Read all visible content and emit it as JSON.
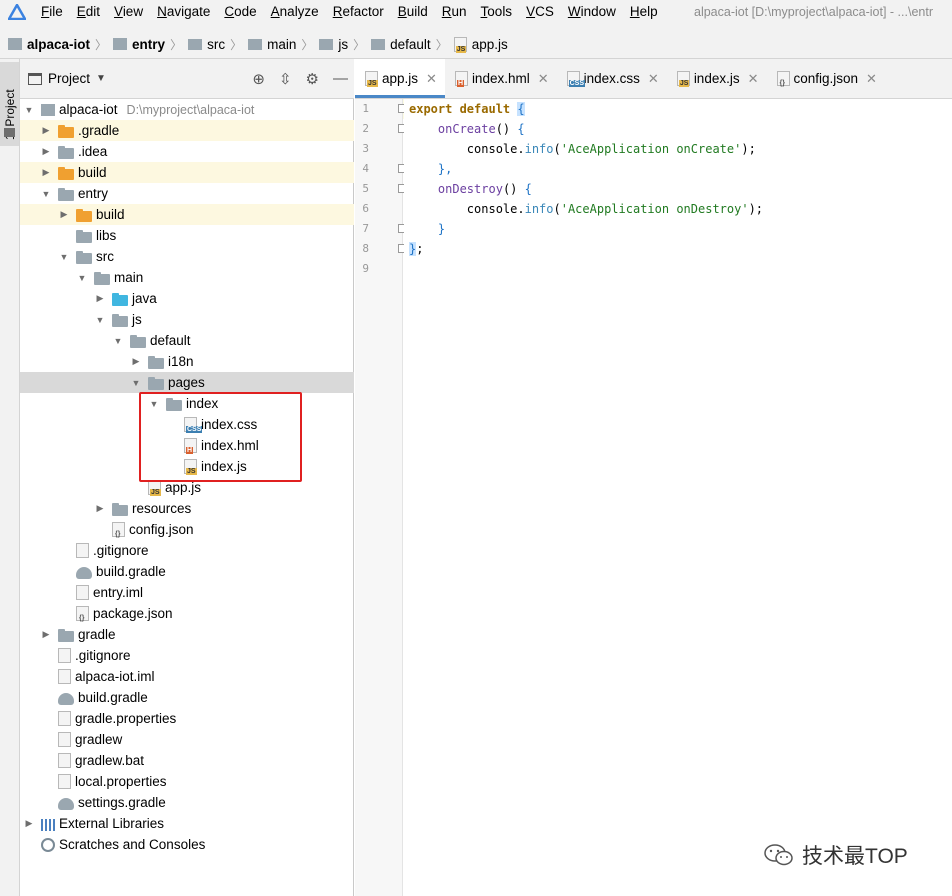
{
  "menubar": {
    "items": [
      "File",
      "Edit",
      "View",
      "Navigate",
      "Code",
      "Analyze",
      "Refactor",
      "Build",
      "Run",
      "Tools",
      "VCS",
      "Window",
      "Help"
    ],
    "window_title": "alpaca-iot [D:\\myproject\\alpaca-iot] - ...\\entr"
  },
  "breadcrumb": [
    "alpaca-iot",
    "entry",
    "src",
    "main",
    "js",
    "default",
    "app.js"
  ],
  "side_strip": {
    "tab_label": "1: Project"
  },
  "project_panel": {
    "title": "Project",
    "tree": [
      {
        "label": "alpaca-iot",
        "path": "D:\\myproject\\alpaca-iot"
      },
      {
        "label": ".gradle"
      },
      {
        "label": ".idea"
      },
      {
        "label": "build"
      },
      {
        "label": "entry"
      },
      {
        "label": "build"
      },
      {
        "label": "libs"
      },
      {
        "label": "src"
      },
      {
        "label": "main"
      },
      {
        "label": "java"
      },
      {
        "label": "js"
      },
      {
        "label": "default"
      },
      {
        "label": "i18n"
      },
      {
        "label": "pages"
      },
      {
        "label": "index"
      },
      {
        "label": "index.css"
      },
      {
        "label": "index.hml"
      },
      {
        "label": "index.js"
      },
      {
        "label": "app.js"
      },
      {
        "label": "resources"
      },
      {
        "label": "config.json"
      },
      {
        "label": ".gitignore"
      },
      {
        "label": "build.gradle"
      },
      {
        "label": "entry.iml"
      },
      {
        "label": "package.json"
      },
      {
        "label": "gradle"
      },
      {
        "label": ".gitignore"
      },
      {
        "label": "alpaca-iot.iml"
      },
      {
        "label": "build.gradle"
      },
      {
        "label": "gradle.properties"
      },
      {
        "label": "gradlew"
      },
      {
        "label": "gradlew.bat"
      },
      {
        "label": "local.properties"
      },
      {
        "label": "settings.gradle"
      },
      {
        "label": "External Libraries"
      },
      {
        "label": "Scratches and Consoles"
      }
    ]
  },
  "editor": {
    "tabs": [
      {
        "label": "app.js",
        "badge": "JS"
      },
      {
        "label": "index.hml",
        "badge": "H"
      },
      {
        "label": "index.css",
        "badge": "CSS"
      },
      {
        "label": "index.js",
        "badge": "JS"
      },
      {
        "label": "config.json",
        "badge": "{}"
      }
    ],
    "line_numbers": [
      "1",
      "2",
      "3",
      "4",
      "5",
      "6",
      "7",
      "8",
      "9"
    ],
    "code": {
      "l1_kw": "export default",
      "l1_brace": "{",
      "l2_fn": "onCreate",
      "l2_rest": "() ",
      "l2_brace": "{",
      "l3_obj": "console.",
      "l3_mth": "info",
      "l3_str": "'AceApplication onCreate'",
      "l3_end": ");",
      "l4": "},",
      "l5_fn": "onDestroy",
      "l5_rest": "() ",
      "l5_brace": "{",
      "l6_obj": "console.",
      "l6_mth": "info",
      "l6_str": "'AceApplication onDestroy'",
      "l6_end": ");",
      "l7": "}",
      "l8_brace": "}",
      "l8_end": ";"
    }
  },
  "watermark": "技术最TOP",
  "colors": {
    "highlight_box": "#e02020",
    "active_tab_underline": "#4a88c7",
    "selected_row": "#d9d9d9"
  }
}
